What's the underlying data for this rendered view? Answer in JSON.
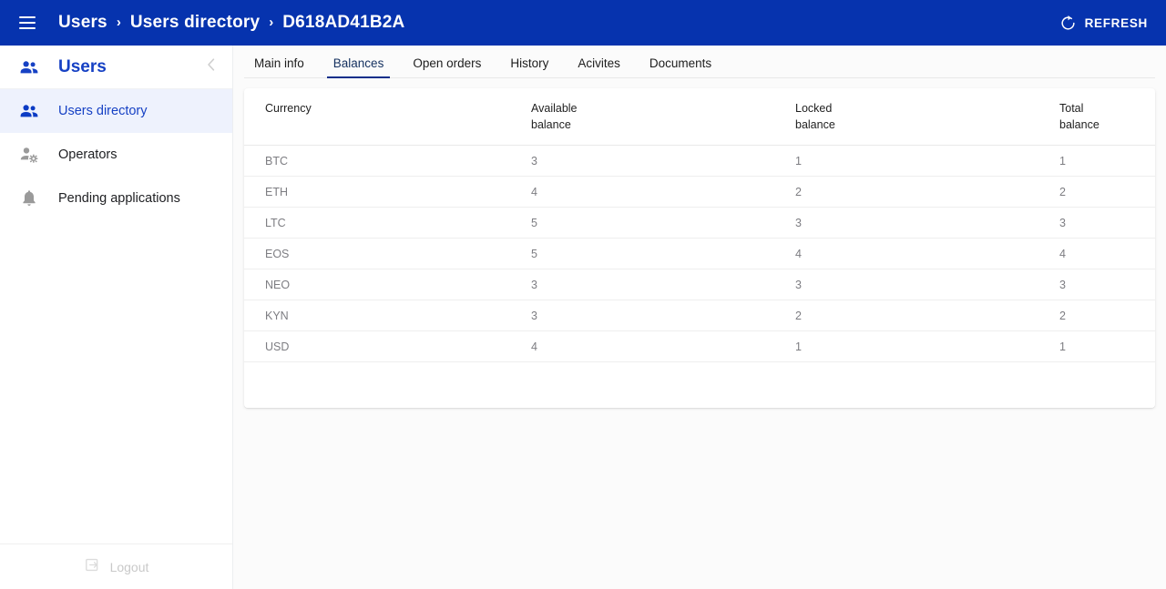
{
  "topbar": {
    "menu_icon": "hamburger-icon",
    "breadcrumb": [
      "Users",
      "Users directory",
      "D618AD41B2A"
    ],
    "separator": "›",
    "refresh_label": "REFRESH",
    "refresh_icon": "refresh-icon",
    "background_color": "#0633ae"
  },
  "sidebar": {
    "title": "Users",
    "title_icon": "people-icon",
    "collapse_icon": "chevron-left-icon",
    "items": [
      {
        "label": "Users directory",
        "icon": "people-icon",
        "active": true
      },
      {
        "label": "Operators",
        "icon": "person-gear-icon",
        "active": false
      },
      {
        "label": "Pending applications",
        "icon": "bell-icon",
        "active": false
      }
    ],
    "logout": {
      "label": "Logout",
      "icon": "logout-icon",
      "disabled": true
    },
    "active_color": "#1641c4",
    "active_bg": "#eef2fd"
  },
  "main": {
    "tabs": [
      {
        "label": "Main info",
        "active": false
      },
      {
        "label": "Balances",
        "active": true
      },
      {
        "label": "Open orders",
        "active": false
      },
      {
        "label": "History",
        "active": false
      },
      {
        "label": "Acivites",
        "active": false
      },
      {
        "label": "Documents",
        "active": false
      }
    ],
    "table": {
      "columns": [
        {
          "line1": "Currency",
          "line2": ""
        },
        {
          "line1": "Available",
          "line2": "balance"
        },
        {
          "line1": "Locked",
          "line2": "balance"
        },
        {
          "line1": "Total",
          "line2": "balance"
        }
      ],
      "rows": [
        {
          "currency": "BTC",
          "available": "3",
          "locked": "1",
          "total": "1"
        },
        {
          "currency": "ETH",
          "available": "4",
          "locked": "2",
          "total": "2"
        },
        {
          "currency": "LTC",
          "available": "5",
          "locked": "3",
          "total": "3"
        },
        {
          "currency": "EOS",
          "available": "5",
          "locked": "4",
          "total": "4"
        },
        {
          "currency": "NEO",
          "available": "3",
          "locked": "3",
          "total": "3"
        },
        {
          "currency": "KYN",
          "available": "3",
          "locked": "2",
          "total": "2"
        },
        {
          "currency": "USD",
          "available": "4",
          "locked": "1",
          "total": "1"
        }
      ]
    }
  }
}
